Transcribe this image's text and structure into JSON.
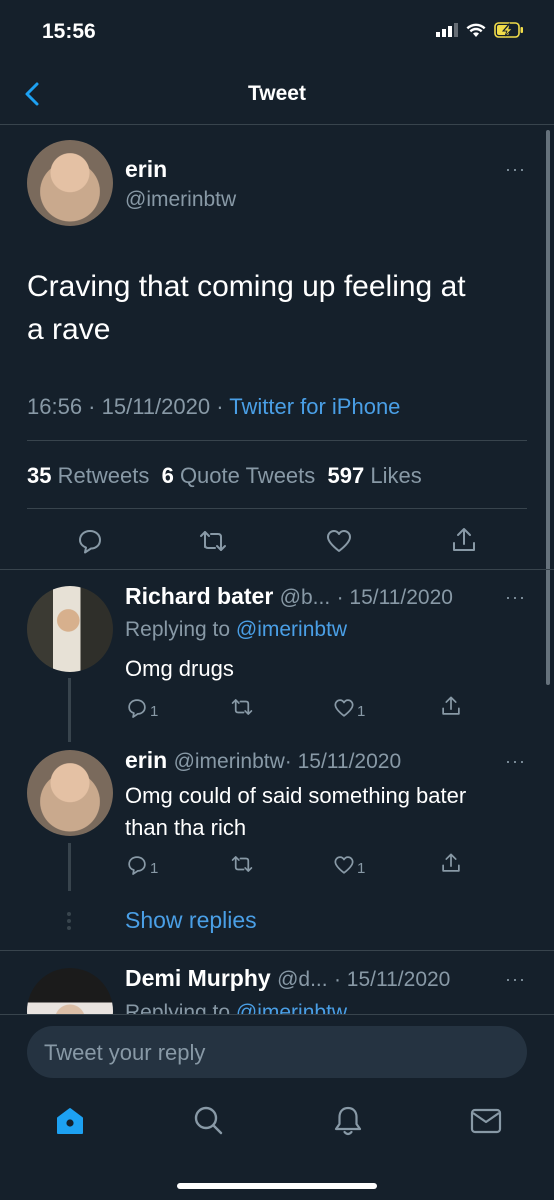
{
  "status": {
    "time": "15:56"
  },
  "nav": {
    "title": "Tweet"
  },
  "tweet": {
    "name": "erin",
    "handle": "@imerinbtw",
    "text_line1": "Craving that coming up feeling at",
    "text_line2": "a rave",
    "time": "16:56 · 15/11/2020 · ",
    "source": "Twitter for iPhone",
    "retweets": "35",
    "retweets_label": "Retweets",
    "quotes": "6",
    "quotes_label": "Quote Tweets",
    "likes": "597",
    "likes_label": "Likes"
  },
  "replies": [
    {
      "name": "Richard bater",
      "handle": "@b...",
      "date": "· 15/11/2020",
      "replying_prefix": "Replying to ",
      "replying_to": "@imerinbtw",
      "text": "Omg drugs",
      "reply_count": "1",
      "like_count": "1"
    },
    {
      "name": "erin",
      "handle": "@imerinbtw",
      "date": "· 15/11/2020",
      "text_line1": "Omg could of said something bater",
      "text_line2": "than tha rich",
      "reply_count": "1",
      "like_count": "1"
    },
    {
      "name": "Demi Murphy",
      "handle": "@d...",
      "date": "· 15/11/2020",
      "replying_prefix": "Replying to ",
      "replying_to": "@imerinbtw"
    }
  ],
  "show_replies": "Show replies",
  "reply_placeholder": "Tweet your reply",
  "more": "···",
  "colors": {
    "background": "#15202b",
    "accent": "#1da1f2",
    "muted": "#8899a6",
    "divider": "#38444d"
  },
  "icons": [
    "back-chevron-icon",
    "reply-icon",
    "retweet-icon",
    "like-icon",
    "share-icon",
    "home-icon",
    "search-icon",
    "notifications-icon",
    "messages-icon"
  ]
}
